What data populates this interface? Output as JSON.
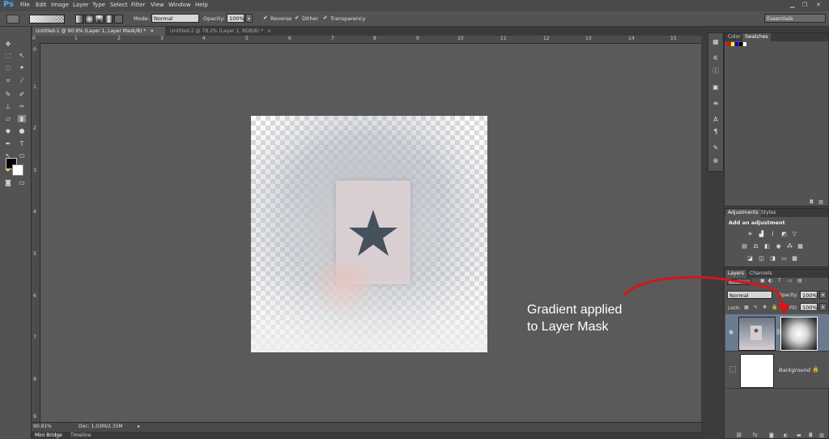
{
  "app": {
    "logo": "Ps"
  },
  "menu": [
    "File",
    "Edit",
    "Image",
    "Layer",
    "Type",
    "Select",
    "Filter",
    "View",
    "Window",
    "Help"
  ],
  "window_controls": [
    "minimize-icon",
    "restore-icon",
    "close-icon"
  ],
  "options": {
    "mode_label": "Mode:",
    "mode_value": "Normal",
    "opacity_label": "Opacity:",
    "opacity_value": "100%",
    "reverse_label": "Reverse",
    "dither_label": "Dither",
    "transparency_label": "Transparency",
    "workspace": "Essentials"
  },
  "tabs": [
    {
      "label": "Untitled-1 @ 90.9% (Layer 1, Layer Mask/8) *",
      "active": true
    },
    {
      "label": "Untitled-2 @ 78.2% (Layer 1, RGB/8) *",
      "active": false
    }
  ],
  "ruler_top": [
    "0",
    "1",
    "2",
    "3",
    "4",
    "5",
    "6",
    "7",
    "8",
    "9",
    "10",
    "11",
    "12",
    "13",
    "14",
    "15"
  ],
  "ruler_left": [
    "0",
    "1",
    "2",
    "3",
    "4",
    "5",
    "6",
    "7",
    "8",
    "9"
  ],
  "status": {
    "zoom": "90.91%",
    "doc": "Doc: 1.03M/2.35M"
  },
  "bottom_tabs": [
    "Mini Bridge",
    "Timeline"
  ],
  "color_panel": {
    "tabs": [
      "Color",
      "Swatches"
    ],
    "swatches": [
      "#ff0000",
      "#ffff00",
      "#0000ff",
      "#000000",
      "#ffffff"
    ]
  },
  "adjustments_panel": {
    "tabs": [
      "Adjustments",
      "Styles"
    ],
    "title": "Add an adjustment"
  },
  "layers_panel": {
    "tabs": [
      "Layers",
      "Channels"
    ],
    "kind": "Kind",
    "blend_mode": "Normal",
    "opacity_label": "Opacity:",
    "opacity_value": "100%",
    "lock_label": "Lock:",
    "fill_label": "Fill:",
    "fill_value": "100%",
    "layers": [
      {
        "name": "",
        "has_mask": true,
        "selected": true
      },
      {
        "name": "Background",
        "has_mask": false,
        "selected": false
      }
    ]
  },
  "annotation": {
    "line1": "Gradient applied",
    "line2": "to Layer Mask",
    "arrow_color": "#d01818"
  }
}
